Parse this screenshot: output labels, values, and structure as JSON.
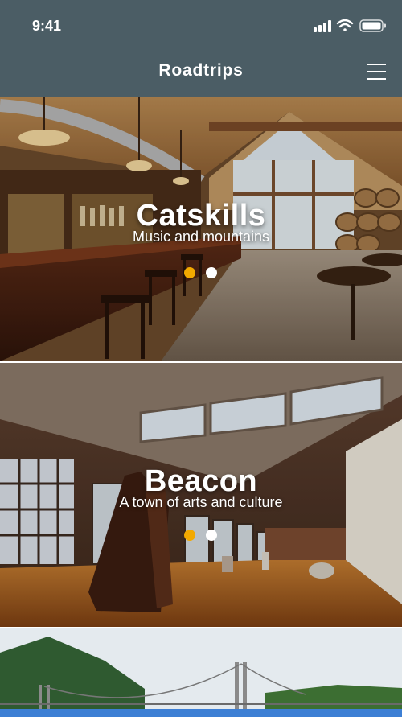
{
  "status_bar": {
    "time": "9:41",
    "icons": [
      "signal-icon",
      "wifi-icon",
      "battery-icon"
    ]
  },
  "header": {
    "title": "Roadtrips",
    "menu_icon": "hamburger-menu-icon",
    "background_color": "#4b5d65"
  },
  "trips": [
    {
      "title": "Catskills",
      "subtitle": "Music and mountains",
      "slide_count": 2,
      "active_slide": 1
    },
    {
      "title": "Beacon",
      "subtitle": "A town of arts and culture",
      "slide_count": 2,
      "active_slide": 1
    }
  ],
  "colors": {
    "active_dot": "#f2a900",
    "inactive_dot": "#ffffff",
    "accent_bar": "#3d7fd4"
  }
}
